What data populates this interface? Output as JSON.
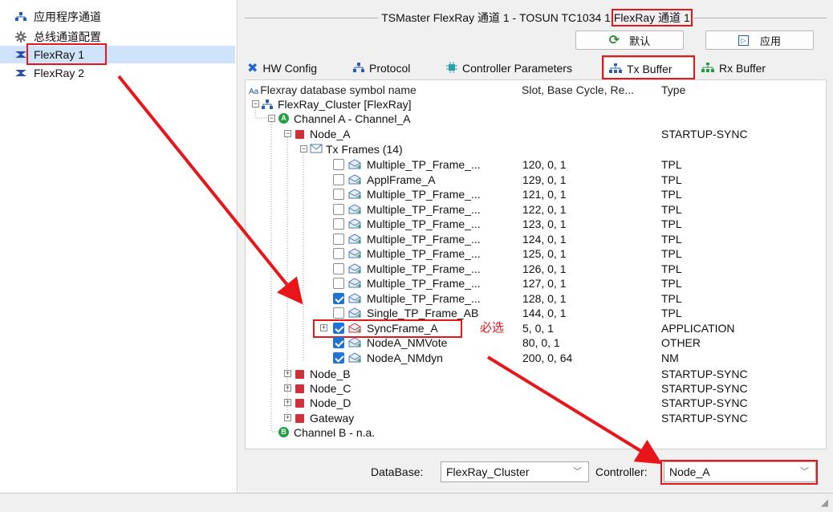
{
  "nav": {
    "items": [
      {
        "label": "应用程序通道",
        "icon": "app-channel-icon"
      },
      {
        "label": "总线通道配置",
        "icon": "gear-icon"
      },
      {
        "label": "FlexRay 1",
        "icon": "flexray-icon"
      },
      {
        "label": "FlexRay 2",
        "icon": "flexray-icon"
      }
    ]
  },
  "header": {
    "title": "TSMaster FlexRay 通道 1 - TOSUN TC1034 1 FlexRay 通道 1",
    "title_main": "TSMaster FlexRay 通道 1 - TOSUN TC1034 1 ",
    "title_hl": "FlexRay 通道 1",
    "default_label": "默认",
    "apply_label": "应用"
  },
  "tabs": [
    "HW Config",
    "Protocol",
    "Controller Parameters",
    "Tx Buffer",
    "Rx Buffer"
  ],
  "columns": [
    "Flexray database symbol name",
    "Slot, Base Cycle, Re...",
    "Type"
  ],
  "tree": {
    "cluster": "FlexRay_Cluster [FlexRay]",
    "channel_a": "Channel A - Channel_A",
    "node_a": {
      "name": "Node_A",
      "type": "STARTUP-SYNC"
    },
    "tx_frames": "Tx Frames (14)",
    "frames": [
      {
        "name": "Multiple_TP_Frame_...",
        "slot": "120, 0, 1",
        "type": "TPL",
        "checked": false
      },
      {
        "name": "ApplFrame_A",
        "slot": "129, 0, 1",
        "type": "TPL",
        "checked": false
      },
      {
        "name": "Multiple_TP_Frame_...",
        "slot": "121, 0, 1",
        "type": "TPL",
        "checked": false
      },
      {
        "name": "Multiple_TP_Frame_...",
        "slot": "122, 0, 1",
        "type": "TPL",
        "checked": false
      },
      {
        "name": "Multiple_TP_Frame_...",
        "slot": "123, 0, 1",
        "type": "TPL",
        "checked": false
      },
      {
        "name": "Multiple_TP_Frame_...",
        "slot": "124, 0, 1",
        "type": "TPL",
        "checked": false
      },
      {
        "name": "Multiple_TP_Frame_...",
        "slot": "125, 0, 1",
        "type": "TPL",
        "checked": false
      },
      {
        "name": "Multiple_TP_Frame_...",
        "slot": "126, 0, 1",
        "type": "TPL",
        "checked": false
      },
      {
        "name": "Multiple_TP_Frame_...",
        "slot": "127, 0, 1",
        "type": "TPL",
        "checked": false
      },
      {
        "name": "Multiple_TP_Frame_...",
        "slot": "128, 0, 1",
        "type": "TPL",
        "checked": true
      },
      {
        "name": "Single_TP_Frame_AB",
        "slot": "144, 0, 1",
        "type": "TPL",
        "checked": false
      },
      {
        "name": "SyncFrame_A",
        "slot": "5, 0, 1",
        "type": "APPLICATION",
        "checked": true
      },
      {
        "name": "NodeA_NMVote",
        "slot": "80, 0, 1",
        "type": "OTHER",
        "checked": true
      },
      {
        "name": "NodeA_NMdyn",
        "slot": "200, 0, 64",
        "type": "NM",
        "checked": true
      }
    ],
    "nodes": [
      {
        "name": "Node_B",
        "type": "STARTUP-SYNC"
      },
      {
        "name": "Node_C",
        "type": "STARTUP-SYNC"
      },
      {
        "name": "Node_D",
        "type": "STARTUP-SYNC"
      },
      {
        "name": "Gateway",
        "type": "STARTUP-SYNC"
      }
    ],
    "channel_b": "Channel B - n.a."
  },
  "annotation": "必选",
  "footer": {
    "database_label": "DataBase:",
    "database_value": "FlexRay_Cluster",
    "controller_label": "Controller:",
    "controller_value": "Node_A"
  },
  "colors": {
    "highlight_red": "#e8151b",
    "selection_blue": "#cfe4fa",
    "check_blue": "#1f73d6"
  }
}
